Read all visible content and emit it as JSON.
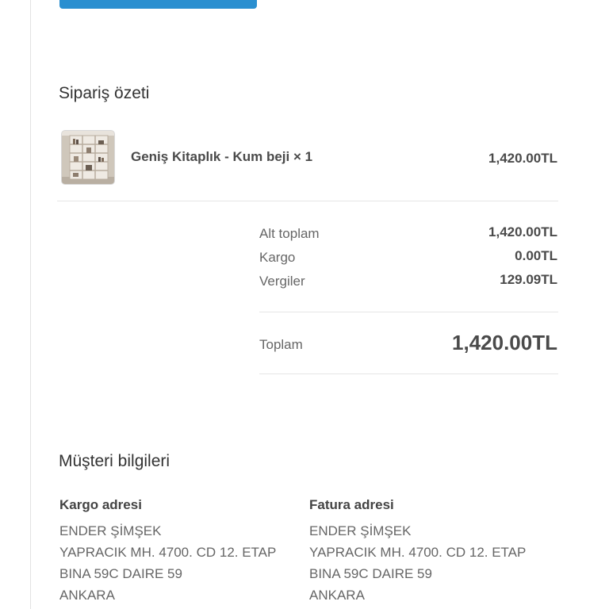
{
  "order_summary": {
    "title": "Sipariş özeti",
    "item": {
      "name": "Geniş Kitaplık - Kum beji × 1",
      "price": "1,420.00TL"
    },
    "rows": {
      "subtotal": {
        "label": "Alt toplam",
        "value": "1,420.00TL"
      },
      "shipping": {
        "label": "Kargo",
        "value": "0.00TL"
      },
      "taxes": {
        "label": "Vergiler",
        "value": "129.09TL"
      }
    },
    "total": {
      "label": "Toplam",
      "value": "1,420.00TL"
    }
  },
  "customer_info": {
    "title": "Müşteri bilgileri",
    "shipping_address": {
      "heading": "Kargo adresi",
      "lines": [
        "ENDER ŞİMŞEK",
        "YAPRACIK MH. 4700. CD 12. ETAP",
        "BINA 59C DAIRE 59",
        "ANKARA"
      ]
    },
    "billing_address": {
      "heading": "Fatura adresi",
      "lines": [
        "ENDER ŞİMŞEK",
        "YAPRACIK MH. 4700. CD 12. ETAP",
        "BINA 59C DAIRE 59",
        "ANKARA"
      ]
    }
  },
  "colors": {
    "accent": "#2a8fd0",
    "text": "#333333",
    "muted": "#666666"
  }
}
